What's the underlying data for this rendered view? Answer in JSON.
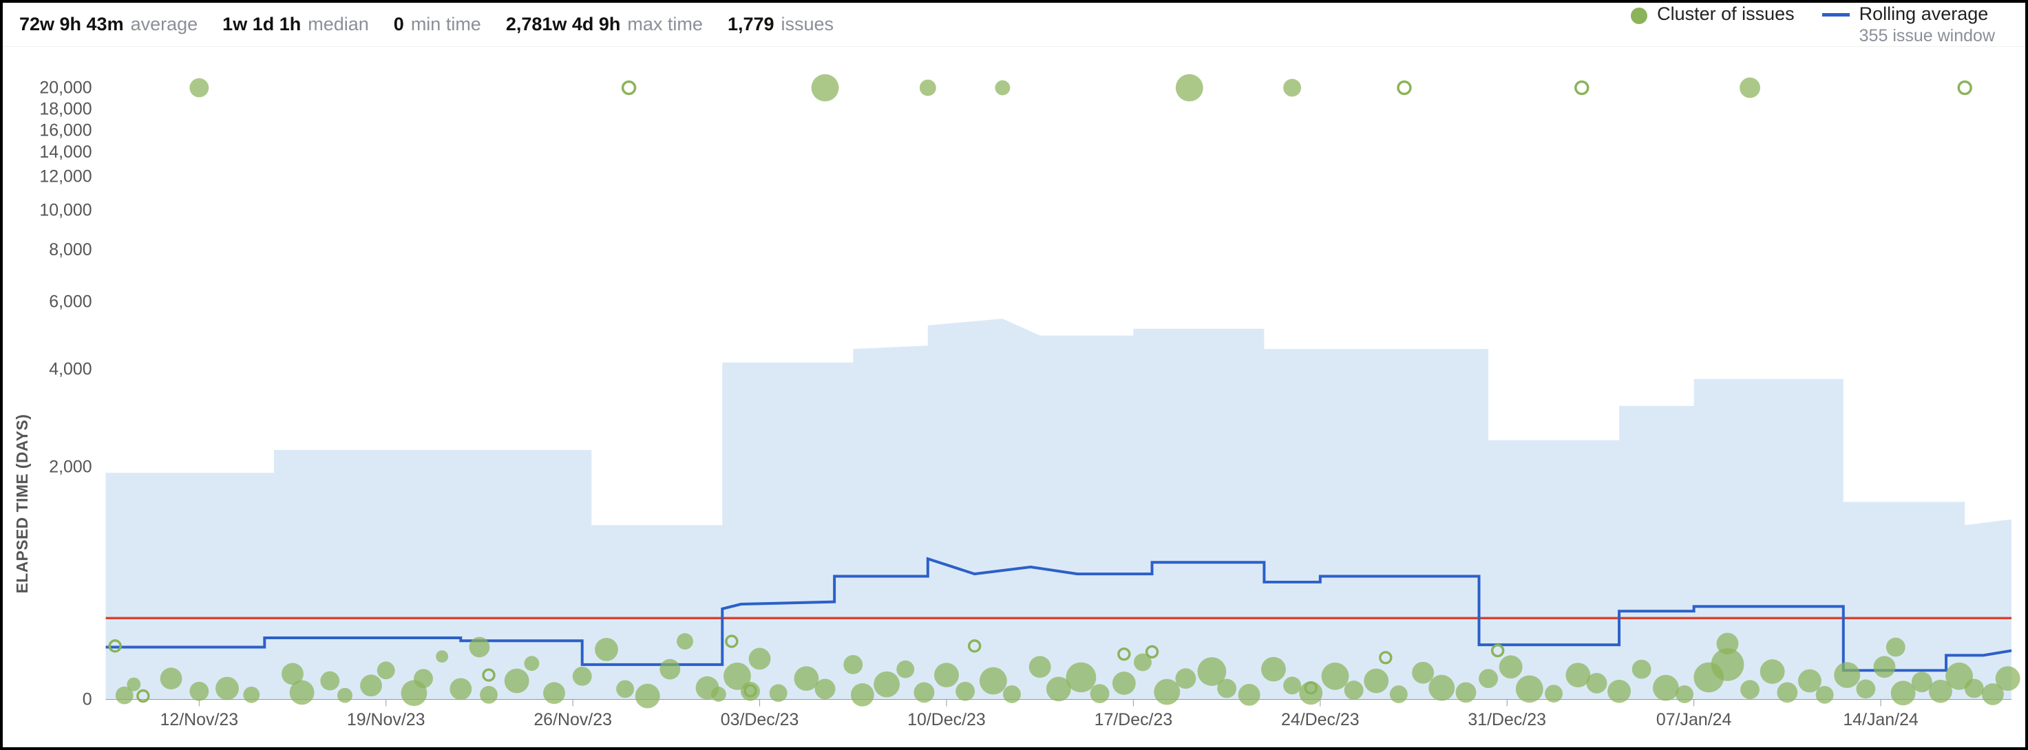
{
  "header": {
    "stats": [
      {
        "value": "72w 9h 43m",
        "label": "average"
      },
      {
        "value": "1w 1d 1h",
        "label": "median"
      },
      {
        "value": "0",
        "label": "min time"
      },
      {
        "value": "2,781w 4d 9h",
        "label": "max time"
      },
      {
        "value": "1,779",
        "label": "issues"
      }
    ]
  },
  "legend": {
    "cluster_label": "Cluster of issues",
    "rolling_label": "Rolling average",
    "rolling_sub": "355 issue window"
  },
  "chart_data": {
    "type": "scatter",
    "ylabel": "ELAPSED TIME (DAYS)",
    "y_ticks": [
      "0",
      "2,000",
      "4,000",
      "6,000",
      "8,000",
      "10,000",
      "12,000",
      "14,000",
      "16,000",
      "18,000",
      "20,000"
    ],
    "y_tick_values": [
      0,
      2000,
      4000,
      6000,
      8000,
      10000,
      12000,
      14000,
      16000,
      18000,
      20000
    ],
    "x_ticks": [
      "12/Nov/23",
      "19/Nov/23",
      "26/Nov/23",
      "03/Dec/23",
      "10/Dec/23",
      "17/Dec/23",
      "24/Dec/23",
      "31/Dec/23",
      "07/Jan/24",
      "14/Jan/24"
    ],
    "x_tick_values": [
      0,
      1,
      2,
      3,
      4,
      5,
      6,
      7,
      8,
      9
    ],
    "x_domain": [
      -0.5,
      9.7
    ],
    "average_line_y": 700,
    "band": [
      {
        "x": -0.5,
        "top": 1950,
        "bottom": 0
      },
      {
        "x": 0.4,
        "top": 1950,
        "bottom": 0
      },
      {
        "x": 0.4,
        "top": 2350,
        "bottom": 0
      },
      {
        "x": 2.1,
        "top": 2350,
        "bottom": 0
      },
      {
        "x": 2.1,
        "top": 1500,
        "bottom": 0
      },
      {
        "x": 2.8,
        "top": 1500,
        "bottom": 0
      },
      {
        "x": 2.8,
        "top": 4200,
        "bottom": 0
      },
      {
        "x": 3.5,
        "top": 4200,
        "bottom": 0
      },
      {
        "x": 3.5,
        "top": 4600,
        "bottom": 0
      },
      {
        "x": 3.9,
        "top": 4700,
        "bottom": 0
      },
      {
        "x": 3.9,
        "top": 5300,
        "bottom": 0
      },
      {
        "x": 4.3,
        "top": 5500,
        "bottom": 0
      },
      {
        "x": 4.5,
        "top": 5000,
        "bottom": 0
      },
      {
        "x": 5.0,
        "top": 5000,
        "bottom": 0
      },
      {
        "x": 5.0,
        "top": 5200,
        "bottom": 0
      },
      {
        "x": 5.7,
        "top": 5200,
        "bottom": 0
      },
      {
        "x": 5.7,
        "top": 4600,
        "bottom": 0
      },
      {
        "x": 6.9,
        "top": 4600,
        "bottom": 0
      },
      {
        "x": 6.9,
        "top": 2550,
        "bottom": 0
      },
      {
        "x": 7.6,
        "top": 2550,
        "bottom": 0
      },
      {
        "x": 7.6,
        "top": 3250,
        "bottom": 0
      },
      {
        "x": 8.0,
        "top": 3250,
        "bottom": 0
      },
      {
        "x": 8.0,
        "top": 3800,
        "bottom": 0
      },
      {
        "x": 8.8,
        "top": 3800,
        "bottom": 0
      },
      {
        "x": 8.8,
        "top": 1700,
        "bottom": 0
      },
      {
        "x": 9.45,
        "top": 1700,
        "bottom": 0
      },
      {
        "x": 9.45,
        "top": 1500,
        "bottom": 0
      },
      {
        "x": 9.7,
        "top": 1550,
        "bottom": 0
      }
    ],
    "rolling": [
      {
        "x": -0.5,
        "y": 450
      },
      {
        "x": 0.35,
        "y": 450
      },
      {
        "x": 0.35,
        "y": 530
      },
      {
        "x": 1.4,
        "y": 530
      },
      {
        "x": 1.4,
        "y": 505
      },
      {
        "x": 2.05,
        "y": 505
      },
      {
        "x": 2.05,
        "y": 300
      },
      {
        "x": 2.8,
        "y": 300
      },
      {
        "x": 2.8,
        "y": 780
      },
      {
        "x": 2.9,
        "y": 820
      },
      {
        "x": 3.4,
        "y": 840
      },
      {
        "x": 3.4,
        "y": 1060
      },
      {
        "x": 3.9,
        "y": 1060
      },
      {
        "x": 3.9,
        "y": 1210
      },
      {
        "x": 4.15,
        "y": 1080
      },
      {
        "x": 4.45,
        "y": 1140
      },
      {
        "x": 4.7,
        "y": 1080
      },
      {
        "x": 5.1,
        "y": 1080
      },
      {
        "x": 5.1,
        "y": 1180
      },
      {
        "x": 5.7,
        "y": 1180
      },
      {
        "x": 5.7,
        "y": 1010
      },
      {
        "x": 6.0,
        "y": 1010
      },
      {
        "x": 6.0,
        "y": 1060
      },
      {
        "x": 6.85,
        "y": 1060
      },
      {
        "x": 6.85,
        "y": 470
      },
      {
        "x": 7.6,
        "y": 470
      },
      {
        "x": 7.6,
        "y": 760
      },
      {
        "x": 8.0,
        "y": 760
      },
      {
        "x": 8.0,
        "y": 800
      },
      {
        "x": 8.8,
        "y": 800
      },
      {
        "x": 8.8,
        "y": 250
      },
      {
        "x": 9.35,
        "y": 250
      },
      {
        "x": 9.35,
        "y": 380
      },
      {
        "x": 9.55,
        "y": 380
      },
      {
        "x": 9.7,
        "y": 420
      }
    ],
    "clusters_filled": [
      {
        "x": 0.0,
        "y": 20000,
        "r": 14
      },
      {
        "x": 3.35,
        "y": 20000,
        "r": 20
      },
      {
        "x": 3.9,
        "y": 20000,
        "r": 12
      },
      {
        "x": 4.3,
        "y": 20000,
        "r": 11
      },
      {
        "x": 5.3,
        "y": 20000,
        "r": 20
      },
      {
        "x": 5.85,
        "y": 20000,
        "r": 13
      },
      {
        "x": 8.3,
        "y": 20000,
        "r": 15
      },
      {
        "x": -0.35,
        "y": 130,
        "r": 10
      },
      {
        "x": -0.4,
        "y": 35,
        "r": 13
      },
      {
        "x": -0.15,
        "y": 180,
        "r": 16
      },
      {
        "x": 0.0,
        "y": 70,
        "r": 14
      },
      {
        "x": 0.15,
        "y": 95,
        "r": 17
      },
      {
        "x": 0.28,
        "y": 40,
        "r": 12
      },
      {
        "x": 0.5,
        "y": 220,
        "r": 16
      },
      {
        "x": 0.55,
        "y": 60,
        "r": 18
      },
      {
        "x": 0.7,
        "y": 160,
        "r": 14
      },
      {
        "x": 0.78,
        "y": 35,
        "r": 11
      },
      {
        "x": 0.92,
        "y": 120,
        "r": 16
      },
      {
        "x": 1.0,
        "y": 250,
        "r": 13
      },
      {
        "x": 1.15,
        "y": 55,
        "r": 19
      },
      {
        "x": 1.2,
        "y": 180,
        "r": 14
      },
      {
        "x": 1.3,
        "y": 370,
        "r": 9
      },
      {
        "x": 1.4,
        "y": 90,
        "r": 16
      },
      {
        "x": 1.5,
        "y": 450,
        "r": 15
      },
      {
        "x": 1.55,
        "y": 40,
        "r": 13
      },
      {
        "x": 1.7,
        "y": 160,
        "r": 18
      },
      {
        "x": 1.78,
        "y": 310,
        "r": 11
      },
      {
        "x": 1.9,
        "y": 55,
        "r": 16
      },
      {
        "x": 2.05,
        "y": 200,
        "r": 14
      },
      {
        "x": 2.18,
        "y": 430,
        "r": 17
      },
      {
        "x": 2.28,
        "y": 90,
        "r": 13
      },
      {
        "x": 2.4,
        "y": 30,
        "r": 18
      },
      {
        "x": 2.52,
        "y": 260,
        "r": 15
      },
      {
        "x": 2.6,
        "y": 500,
        "r": 12
      },
      {
        "x": 2.72,
        "y": 100,
        "r": 17
      },
      {
        "x": 2.78,
        "y": 45,
        "r": 11
      },
      {
        "x": 2.88,
        "y": 200,
        "r": 20
      },
      {
        "x": 2.95,
        "y": 70,
        "r": 14
      },
      {
        "x": 3.0,
        "y": 350,
        "r": 16
      },
      {
        "x": 3.1,
        "y": 55,
        "r": 13
      },
      {
        "x": 3.25,
        "y": 180,
        "r": 18
      },
      {
        "x": 3.35,
        "y": 90,
        "r": 15
      },
      {
        "x": 3.5,
        "y": 300,
        "r": 14
      },
      {
        "x": 3.55,
        "y": 40,
        "r": 17
      },
      {
        "x": 3.68,
        "y": 130,
        "r": 19
      },
      {
        "x": 3.78,
        "y": 260,
        "r": 13
      },
      {
        "x": 3.88,
        "y": 60,
        "r": 15
      },
      {
        "x": 4.0,
        "y": 210,
        "r": 18
      },
      {
        "x": 4.1,
        "y": 70,
        "r": 14
      },
      {
        "x": 4.25,
        "y": 160,
        "r": 20
      },
      {
        "x": 4.35,
        "y": 45,
        "r": 13
      },
      {
        "x": 4.5,
        "y": 280,
        "r": 16
      },
      {
        "x": 4.6,
        "y": 90,
        "r": 18
      },
      {
        "x": 4.72,
        "y": 190,
        "r": 22
      },
      {
        "x": 4.82,
        "y": 50,
        "r": 14
      },
      {
        "x": 4.95,
        "y": 140,
        "r": 17
      },
      {
        "x": 5.05,
        "y": 320,
        "r": 13
      },
      {
        "x": 5.18,
        "y": 65,
        "r": 19
      },
      {
        "x": 5.28,
        "y": 180,
        "r": 15
      },
      {
        "x": 5.42,
        "y": 240,
        "r": 21
      },
      {
        "x": 5.5,
        "y": 95,
        "r": 14
      },
      {
        "x": 5.62,
        "y": 40,
        "r": 16
      },
      {
        "x": 5.75,
        "y": 260,
        "r": 18
      },
      {
        "x": 5.85,
        "y": 120,
        "r": 13
      },
      {
        "x": 5.95,
        "y": 55,
        "r": 17
      },
      {
        "x": 6.08,
        "y": 200,
        "r": 20
      },
      {
        "x": 6.18,
        "y": 80,
        "r": 14
      },
      {
        "x": 6.3,
        "y": 160,
        "r": 18
      },
      {
        "x": 6.42,
        "y": 45,
        "r": 13
      },
      {
        "x": 6.55,
        "y": 230,
        "r": 16
      },
      {
        "x": 6.65,
        "y": 100,
        "r": 19
      },
      {
        "x": 6.78,
        "y": 60,
        "r": 15
      },
      {
        "x": 6.9,
        "y": 180,
        "r": 14
      },
      {
        "x": 7.02,
        "y": 280,
        "r": 17
      },
      {
        "x": 7.12,
        "y": 90,
        "r": 20
      },
      {
        "x": 7.25,
        "y": 50,
        "r": 13
      },
      {
        "x": 7.38,
        "y": 210,
        "r": 18
      },
      {
        "x": 7.48,
        "y": 140,
        "r": 15
      },
      {
        "x": 7.6,
        "y": 70,
        "r": 17
      },
      {
        "x": 7.72,
        "y": 260,
        "r": 14
      },
      {
        "x": 7.85,
        "y": 100,
        "r": 19
      },
      {
        "x": 7.95,
        "y": 45,
        "r": 13
      },
      {
        "x": 8.08,
        "y": 190,
        "r": 22
      },
      {
        "x": 8.18,
        "y": 300,
        "r": 24
      },
      {
        "x": 8.18,
        "y": 480,
        "r": 16
      },
      {
        "x": 8.3,
        "y": 85,
        "r": 14
      },
      {
        "x": 8.42,
        "y": 240,
        "r": 18
      },
      {
        "x": 8.5,
        "y": 60,
        "r": 15
      },
      {
        "x": 8.62,
        "y": 160,
        "r": 17
      },
      {
        "x": 8.7,
        "y": 40,
        "r": 13
      },
      {
        "x": 8.82,
        "y": 210,
        "r": 19
      },
      {
        "x": 8.92,
        "y": 90,
        "r": 14
      },
      {
        "x": 9.02,
        "y": 280,
        "r": 16
      },
      {
        "x": 9.08,
        "y": 450,
        "r": 14
      },
      {
        "x": 9.12,
        "y": 55,
        "r": 18
      },
      {
        "x": 9.22,
        "y": 150,
        "r": 15
      },
      {
        "x": 9.32,
        "y": 70,
        "r": 17
      },
      {
        "x": 9.42,
        "y": 200,
        "r": 20
      },
      {
        "x": 9.5,
        "y": 95,
        "r": 14
      },
      {
        "x": 9.6,
        "y": 45,
        "r": 16
      },
      {
        "x": 9.68,
        "y": 180,
        "r": 18
      }
    ],
    "clusters_open": [
      {
        "x": 2.3,
        "y": 20000,
        "r": 9
      },
      {
        "x": 6.45,
        "y": 20000,
        "r": 9
      },
      {
        "x": 7.4,
        "y": 20000,
        "r": 9
      },
      {
        "x": 9.45,
        "y": 20000,
        "r": 9
      },
      {
        "x": -0.45,
        "y": 460,
        "r": 8
      },
      {
        "x": -0.3,
        "y": 30,
        "r": 8
      },
      {
        "x": 1.55,
        "y": 210,
        "r": 8
      },
      {
        "x": 2.85,
        "y": 500,
        "r": 8
      },
      {
        "x": 2.95,
        "y": 75,
        "r": 8
      },
      {
        "x": 4.15,
        "y": 460,
        "r": 8
      },
      {
        "x": 4.95,
        "y": 390,
        "r": 8
      },
      {
        "x": 5.1,
        "y": 410,
        "r": 8
      },
      {
        "x": 5.95,
        "y": 100,
        "r": 8
      },
      {
        "x": 6.35,
        "y": 360,
        "r": 8
      },
      {
        "x": 6.95,
        "y": 420,
        "r": 8
      }
    ]
  }
}
